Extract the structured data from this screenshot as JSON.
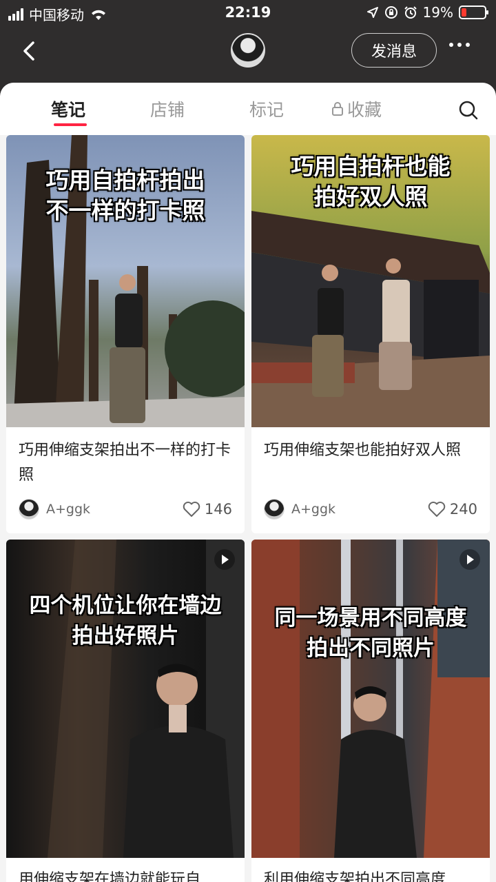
{
  "status_bar": {
    "carrier": "中国移动",
    "time": "22:19",
    "battery": "19%"
  },
  "nav": {
    "message_button": "发消息"
  },
  "tabs": [
    {
      "label": "笔记",
      "active": true,
      "locked": false
    },
    {
      "label": "店铺",
      "active": false,
      "locked": false
    },
    {
      "label": "标记",
      "active": false,
      "locked": false
    },
    {
      "label": "收藏",
      "active": false,
      "locked": true
    }
  ],
  "notes": [
    {
      "overlay_lines": [
        "巧用自拍杆拍出",
        "不一样的打卡照"
      ],
      "title": "巧用伸缩支架拍出不一样的打卡照",
      "author": "A+ggk",
      "likes": "146"
    },
    {
      "overlay_lines": [
        "巧用自拍杆也能",
        "拍好双人照"
      ],
      "title": "巧用伸缩支架也能拍好双人照",
      "author": "A+ggk",
      "likes": "240"
    },
    {
      "overlay_lines": [
        "四个机位让你在墙边",
        "拍出好照片"
      ],
      "title": "用伸缩支架在墙边就能玩自",
      "author": "",
      "likes": ""
    },
    {
      "overlay_lines": [
        "同一场景用不同高度",
        "拍出不同照片"
      ],
      "title": "利用伸缩支架拍出不同高度",
      "author": "",
      "likes": ""
    }
  ],
  "colors": {
    "accent": "#ff2442",
    "header_bg": "#2f2d2d",
    "battery_low": "#ff3b30"
  }
}
